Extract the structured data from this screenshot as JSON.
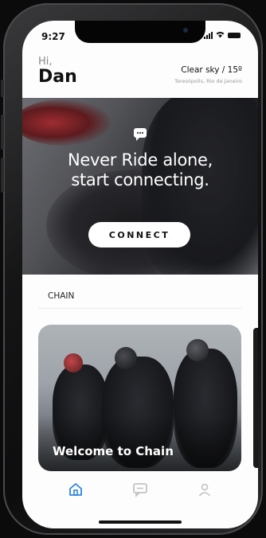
{
  "status_bar": {
    "time": "9:27"
  },
  "header": {
    "greeting": "Hi,",
    "user_name": "Dan",
    "weather": "Clear sky / 15º",
    "location": "Teresópolis, Rio de Janeiro"
  },
  "hero": {
    "icon": "chat-bubble-icon",
    "title_line1": "Never Ride alone,",
    "title_line2": "start connecting.",
    "button_label": "CONNECT"
  },
  "section": {
    "label": "CHAIN"
  },
  "card": {
    "title": "Welcome to Chain"
  },
  "tab_bar": {
    "items": [
      {
        "icon": "home-icon",
        "active": true
      },
      {
        "icon": "chat-icon",
        "active": false
      },
      {
        "icon": "profile-icon",
        "active": false
      }
    ],
    "active_color": "#2e86de",
    "inactive_color": "#c2c2c2"
  }
}
